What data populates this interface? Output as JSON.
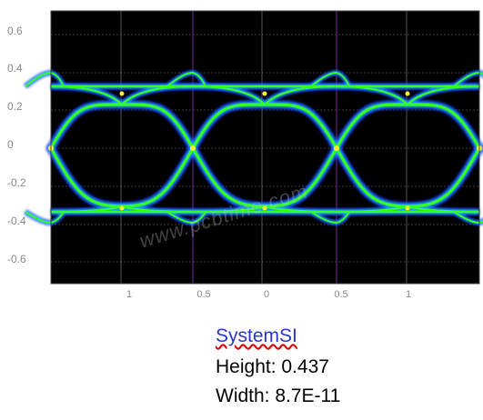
{
  "plot": {
    "y_ticks": [
      "0.6",
      "0.4",
      "0.2",
      "0",
      "-0.2",
      "-0.4",
      "-0.6"
    ],
    "x_ticks": [
      "1",
      "0.5",
      "0",
      "0.5",
      "1"
    ],
    "watermark": "www.pcbtime.com",
    "colors": {
      "background": "#000000",
      "core": "#33ff22",
      "mid": "#1fa8ff",
      "outer": "#1a2aff",
      "grid": "#7a7a7a"
    }
  },
  "results": {
    "link_label": "SystemSI",
    "height_text": "Height: 0.437",
    "width_text": "Width: 8.7E-11"
  }
}
